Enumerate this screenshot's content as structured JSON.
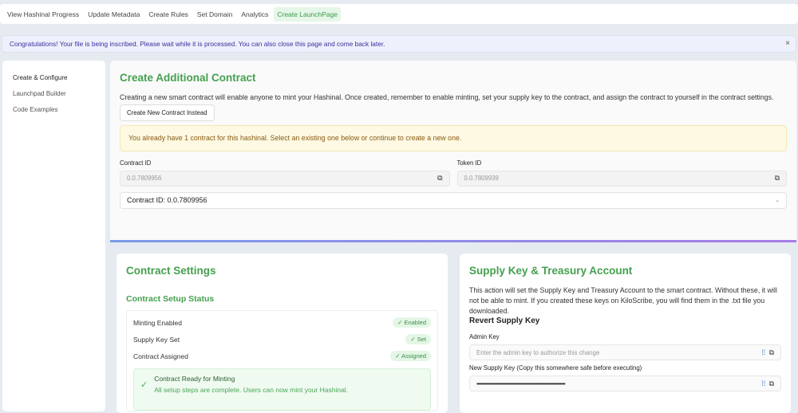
{
  "nav": {
    "tabs": [
      "View Hashinal Progress",
      "Update Metadata",
      "Create Rules",
      "Set Domain",
      "Analytics",
      "Create LaunchPage"
    ],
    "active": 5
  },
  "alert": {
    "text": "Congratulations! Your file is being inscribed. Please wait while it is processed. You can also close this page and come back later.",
    "close": "×"
  },
  "sidebar": {
    "items": [
      "Create & Configure",
      "Launchpad Builder",
      "Code Examples"
    ]
  },
  "main": {
    "title": "Create Additional Contract",
    "description": "Creating a new smart contract will enable anyone to mint your Hashinal. Once created, remember to enable minting, set your supply key to the contract, and assign the contract to yourself in the contract settings.",
    "new_contract_button": "Create New Contract Instead",
    "warning": "You already have 1 contract for this hashinal. Select an existing one below or continue to create a new one.",
    "contract_id_label": "Contract ID",
    "contract_id": "0.0.7809956",
    "token_id_label": "Token ID",
    "token_id": "0.0.7809939",
    "select_value": "Contract ID: 0.0.7809956"
  },
  "settings": {
    "title": "Contract Settings",
    "subtitle": "Contract Setup Status",
    "rows": [
      {
        "label": "Minting Enabled",
        "badge": "✓ Enabled"
      },
      {
        "label": "Supply Key Set",
        "badge": "✓ Set"
      },
      {
        "label": "Contract Assigned",
        "badge": "✓ Assigned"
      }
    ],
    "ready_title": "Contract Ready for Minting",
    "ready_text": "All setup steps are complete. Users can now mint your Hashinal."
  },
  "supply": {
    "title": "Supply Key & Treasury Account",
    "description": "This action will set the Supply Key and Treasury Account to the smart contract. Without these, it will not be able to mint. If you created these keys on KiloScribe, you will find them in the .txt file you downloaded.",
    "revert_title": "Revert Supply Key",
    "admin_label": "Admin Key",
    "admin_placeholder": "Enter the admin key to authorize this change",
    "new_label": "New Supply Key (Copy this somewhere safe before executing)",
    "new_value": "••••••••••••••••••••••••••••••••••••••••••••••••••••••••••••••••"
  }
}
